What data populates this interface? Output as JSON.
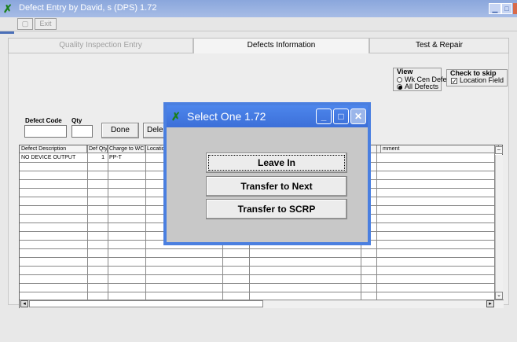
{
  "window": {
    "title": "Defect Entry by  David, s (DPS)    1.72",
    "exit_label": "Exit"
  },
  "tabs": [
    {
      "label": "Quality Inspection Entry",
      "active": false
    },
    {
      "label": "Defects Information",
      "active": true
    },
    {
      "label": "Test & Repair",
      "active": false
    }
  ],
  "view_group": {
    "legend": "View",
    "options": [
      {
        "label": "Wk Cen Defects",
        "selected": false
      },
      {
        "label": "All Defects",
        "selected": true
      }
    ]
  },
  "skip_group": {
    "legend": "Check to skip",
    "checkbox_label": "Location Field",
    "checked": true
  },
  "form": {
    "defect_code_label": "Defect Code",
    "qty_label": "Qty",
    "done_label": "Done",
    "delete_label": "Dele"
  },
  "grid": {
    "columns": [
      "Defect Description",
      "Def Qty",
      "Charge to WC",
      "Locatio",
      "mment"
    ],
    "rows": [
      {
        "description": "NO DEVICE OUTPUT",
        "qty": "1",
        "charge": "PP-T"
      }
    ]
  },
  "dialog": {
    "title": "Select One    1.72",
    "buttons": [
      "Leave In",
      "Transfer to Next",
      "Transfer to SCRP"
    ]
  },
  "colors": {
    "title_bar": "#8aa6dc",
    "dialog_border": "#4a7fe0",
    "app_icon": "#1a7f1a"
  }
}
